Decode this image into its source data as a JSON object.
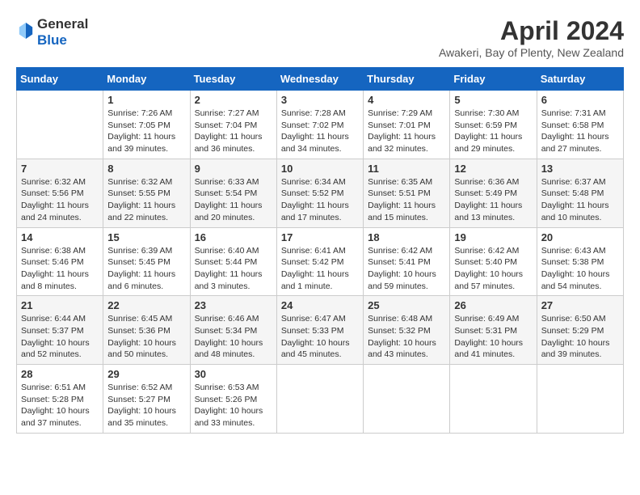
{
  "logo": {
    "line1": "General",
    "line2": "Blue"
  },
  "title": "April 2024",
  "location": "Awakeri, Bay of Plenty, New Zealand",
  "weekdays": [
    "Sunday",
    "Monday",
    "Tuesday",
    "Wednesday",
    "Thursday",
    "Friday",
    "Saturday"
  ],
  "weeks": [
    [
      {
        "day": "",
        "sunrise": "",
        "sunset": "",
        "daylight": ""
      },
      {
        "day": "1",
        "sunrise": "Sunrise: 7:26 AM",
        "sunset": "Sunset: 7:05 PM",
        "daylight": "Daylight: 11 hours and 39 minutes."
      },
      {
        "day": "2",
        "sunrise": "Sunrise: 7:27 AM",
        "sunset": "Sunset: 7:04 PM",
        "daylight": "Daylight: 11 hours and 36 minutes."
      },
      {
        "day": "3",
        "sunrise": "Sunrise: 7:28 AM",
        "sunset": "Sunset: 7:02 PM",
        "daylight": "Daylight: 11 hours and 34 minutes."
      },
      {
        "day": "4",
        "sunrise": "Sunrise: 7:29 AM",
        "sunset": "Sunset: 7:01 PM",
        "daylight": "Daylight: 11 hours and 32 minutes."
      },
      {
        "day": "5",
        "sunrise": "Sunrise: 7:30 AM",
        "sunset": "Sunset: 6:59 PM",
        "daylight": "Daylight: 11 hours and 29 minutes."
      },
      {
        "day": "6",
        "sunrise": "Sunrise: 7:31 AM",
        "sunset": "Sunset: 6:58 PM",
        "daylight": "Daylight: 11 hours and 27 minutes."
      }
    ],
    [
      {
        "day": "7",
        "sunrise": "Sunrise: 6:32 AM",
        "sunset": "Sunset: 5:56 PM",
        "daylight": "Daylight: 11 hours and 24 minutes."
      },
      {
        "day": "8",
        "sunrise": "Sunrise: 6:32 AM",
        "sunset": "Sunset: 5:55 PM",
        "daylight": "Daylight: 11 hours and 22 minutes."
      },
      {
        "day": "9",
        "sunrise": "Sunrise: 6:33 AM",
        "sunset": "Sunset: 5:54 PM",
        "daylight": "Daylight: 11 hours and 20 minutes."
      },
      {
        "day": "10",
        "sunrise": "Sunrise: 6:34 AM",
        "sunset": "Sunset: 5:52 PM",
        "daylight": "Daylight: 11 hours and 17 minutes."
      },
      {
        "day": "11",
        "sunrise": "Sunrise: 6:35 AM",
        "sunset": "Sunset: 5:51 PM",
        "daylight": "Daylight: 11 hours and 15 minutes."
      },
      {
        "day": "12",
        "sunrise": "Sunrise: 6:36 AM",
        "sunset": "Sunset: 5:49 PM",
        "daylight": "Daylight: 11 hours and 13 minutes."
      },
      {
        "day": "13",
        "sunrise": "Sunrise: 6:37 AM",
        "sunset": "Sunset: 5:48 PM",
        "daylight": "Daylight: 11 hours and 10 minutes."
      }
    ],
    [
      {
        "day": "14",
        "sunrise": "Sunrise: 6:38 AM",
        "sunset": "Sunset: 5:46 PM",
        "daylight": "Daylight: 11 hours and 8 minutes."
      },
      {
        "day": "15",
        "sunrise": "Sunrise: 6:39 AM",
        "sunset": "Sunset: 5:45 PM",
        "daylight": "Daylight: 11 hours and 6 minutes."
      },
      {
        "day": "16",
        "sunrise": "Sunrise: 6:40 AM",
        "sunset": "Sunset: 5:44 PM",
        "daylight": "Daylight: 11 hours and 3 minutes."
      },
      {
        "day": "17",
        "sunrise": "Sunrise: 6:41 AM",
        "sunset": "Sunset: 5:42 PM",
        "daylight": "Daylight: 11 hours and 1 minute."
      },
      {
        "day": "18",
        "sunrise": "Sunrise: 6:42 AM",
        "sunset": "Sunset: 5:41 PM",
        "daylight": "Daylight: 10 hours and 59 minutes."
      },
      {
        "day": "19",
        "sunrise": "Sunrise: 6:42 AM",
        "sunset": "Sunset: 5:40 PM",
        "daylight": "Daylight: 10 hours and 57 minutes."
      },
      {
        "day": "20",
        "sunrise": "Sunrise: 6:43 AM",
        "sunset": "Sunset: 5:38 PM",
        "daylight": "Daylight: 10 hours and 54 minutes."
      }
    ],
    [
      {
        "day": "21",
        "sunrise": "Sunrise: 6:44 AM",
        "sunset": "Sunset: 5:37 PM",
        "daylight": "Daylight: 10 hours and 52 minutes."
      },
      {
        "day": "22",
        "sunrise": "Sunrise: 6:45 AM",
        "sunset": "Sunset: 5:36 PM",
        "daylight": "Daylight: 10 hours and 50 minutes."
      },
      {
        "day": "23",
        "sunrise": "Sunrise: 6:46 AM",
        "sunset": "Sunset: 5:34 PM",
        "daylight": "Daylight: 10 hours and 48 minutes."
      },
      {
        "day": "24",
        "sunrise": "Sunrise: 6:47 AM",
        "sunset": "Sunset: 5:33 PM",
        "daylight": "Daylight: 10 hours and 45 minutes."
      },
      {
        "day": "25",
        "sunrise": "Sunrise: 6:48 AM",
        "sunset": "Sunset: 5:32 PM",
        "daylight": "Daylight: 10 hours and 43 minutes."
      },
      {
        "day": "26",
        "sunrise": "Sunrise: 6:49 AM",
        "sunset": "Sunset: 5:31 PM",
        "daylight": "Daylight: 10 hours and 41 minutes."
      },
      {
        "day": "27",
        "sunrise": "Sunrise: 6:50 AM",
        "sunset": "Sunset: 5:29 PM",
        "daylight": "Daylight: 10 hours and 39 minutes."
      }
    ],
    [
      {
        "day": "28",
        "sunrise": "Sunrise: 6:51 AM",
        "sunset": "Sunset: 5:28 PM",
        "daylight": "Daylight: 10 hours and 37 minutes."
      },
      {
        "day": "29",
        "sunrise": "Sunrise: 6:52 AM",
        "sunset": "Sunset: 5:27 PM",
        "daylight": "Daylight: 10 hours and 35 minutes."
      },
      {
        "day": "30",
        "sunrise": "Sunrise: 6:53 AM",
        "sunset": "Sunset: 5:26 PM",
        "daylight": "Daylight: 10 hours and 33 minutes."
      },
      {
        "day": "",
        "sunrise": "",
        "sunset": "",
        "daylight": ""
      },
      {
        "day": "",
        "sunrise": "",
        "sunset": "",
        "daylight": ""
      },
      {
        "day": "",
        "sunrise": "",
        "sunset": "",
        "daylight": ""
      },
      {
        "day": "",
        "sunrise": "",
        "sunset": "",
        "daylight": ""
      }
    ]
  ]
}
